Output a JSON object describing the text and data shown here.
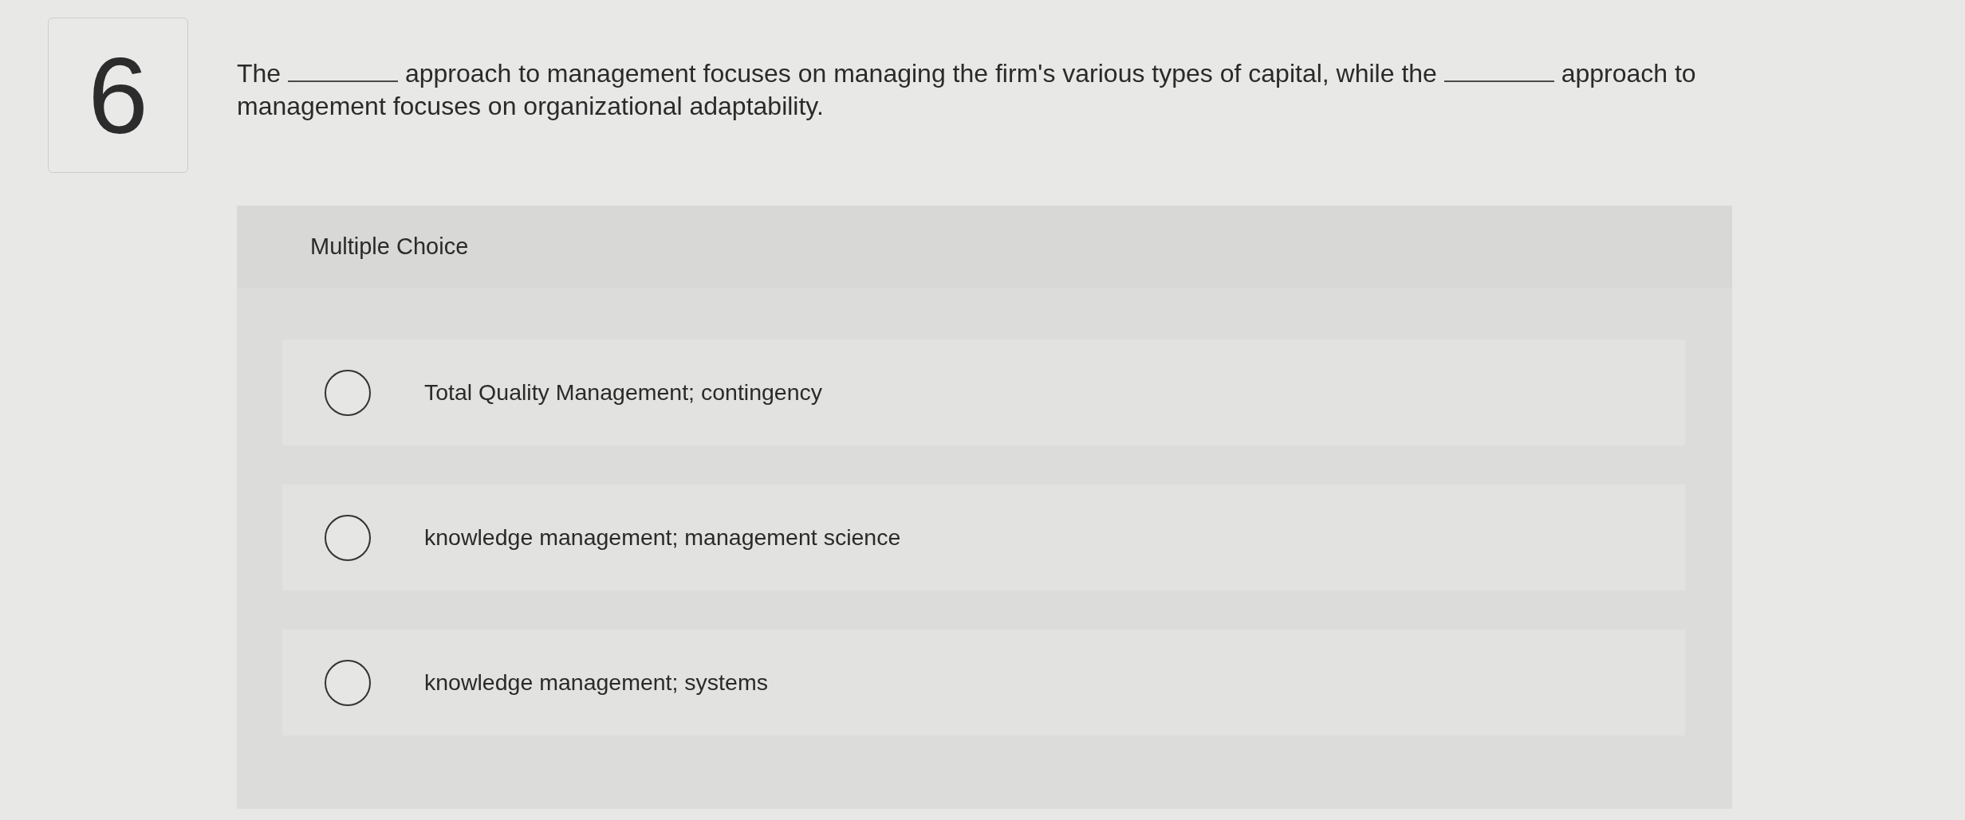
{
  "question": {
    "number": "6",
    "parts": [
      {
        "kind": "text",
        "text": "The"
      },
      {
        "kind": "blank"
      },
      {
        "kind": "text",
        "text": "approach to management focuses on managing the firm's various types of capital, while the"
      },
      {
        "kind": "blank"
      },
      {
        "kind": "text",
        "text": "approach to management focuses on organizational adaptability."
      }
    ]
  },
  "answer_panel": {
    "heading": "Multiple Choice",
    "options": [
      {
        "label": "Total Quality Management; contingency",
        "selected": false
      },
      {
        "label": "knowledge management; management science",
        "selected": false
      },
      {
        "label": "knowledge management; systems",
        "selected": false
      }
    ]
  }
}
